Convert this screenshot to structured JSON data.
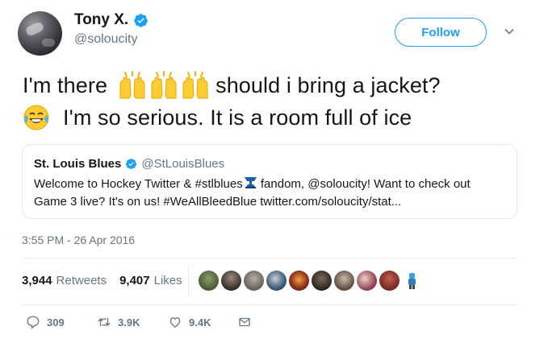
{
  "author": {
    "name": "Tony X.",
    "handle": "@soloucity",
    "verified": true
  },
  "follow_button": {
    "label": "Follow"
  },
  "tweet": {
    "line1_a": "I'm there",
    "line1_b": "should i bring a jacket?",
    "line2": "I'm so serious.  It is a room full of ice",
    "emojis": [
      "raising-hands-icon",
      "raising-hands-icon",
      "raising-hands-icon",
      "crying-laughing-face-icon"
    ]
  },
  "quoted_tweet": {
    "name": "St. Louis Blues",
    "handle": "@StLouisBlues",
    "text_a": "Welcome to Hockey Twitter & #stlblues",
    "text_b": " fandom, @soloucity! Want to check out",
    "text_c": "Game 3 live? It's on us! #WeAllBleedBlue twitter.com/soloucity/stat..."
  },
  "timestamp": "3:55 PM - 26 Apr 2016",
  "stats": {
    "retweets_count": "3,944",
    "retweets_label": "Retweets",
    "likes_count": "9,407",
    "likes_label": "Likes"
  },
  "likers": [
    "liker-avatar-1",
    "liker-avatar-2",
    "liker-avatar-3",
    "liker-avatar-4",
    "liker-avatar-5",
    "liker-avatar-6",
    "liker-avatar-7",
    "liker-avatar-8",
    "liker-avatar-9",
    "liker-avatar-10"
  ],
  "actions": {
    "reply_count": "309",
    "retweet_count": "3.9K",
    "like_count": "9.4K"
  },
  "colors": {
    "accent": "#1da1f2",
    "secondary_text": "#657786",
    "divider": "#e6ecf0"
  }
}
